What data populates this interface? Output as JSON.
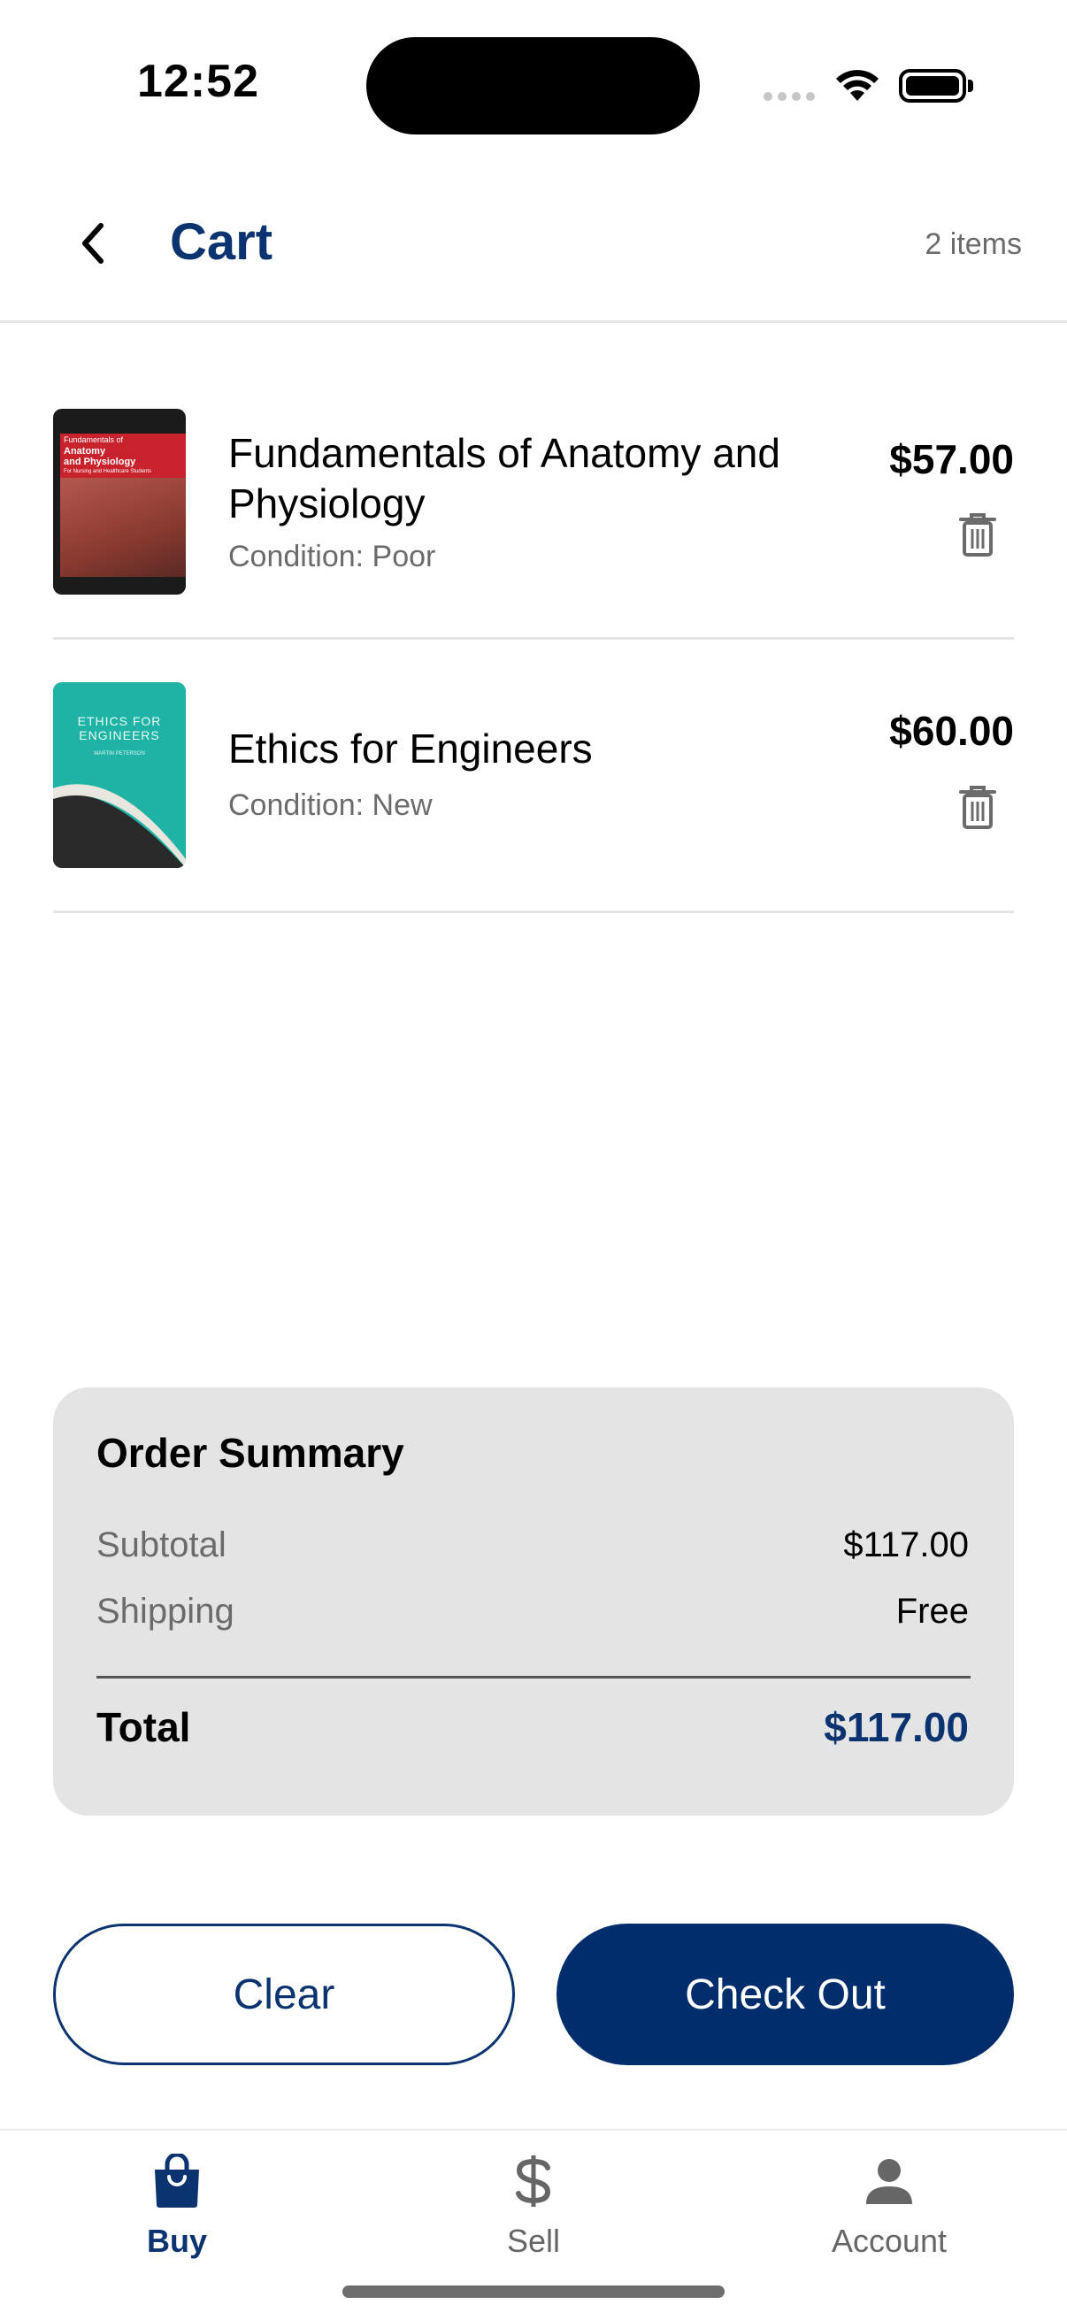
{
  "status_bar": {
    "time": "12:52"
  },
  "header": {
    "title": "Cart",
    "item_count": "2 items"
  },
  "cart": {
    "items": [
      {
        "title": "Fundamentals of Anatomy and Physiology",
        "condition": "Condition: Poor",
        "price": "$57.00",
        "cover": {
          "colors": [
            "#1b1b1b",
            "#c8232c",
            "#b5574f"
          ],
          "text": [
            "Fundamentals of",
            "Anatomy",
            "and Physiology",
            "For Nursing and Healthcare Students"
          ]
        }
      },
      {
        "title": "Ethics for Engineers",
        "condition": "Condition: New",
        "price": "$60.00",
        "cover": {
          "colors": [
            "#1fb3a5",
            "#2a2a2a"
          ],
          "text": [
            "ETHICS FOR",
            "ENGINEERS",
            "MARTIN PETERSON"
          ]
        }
      }
    ]
  },
  "order_summary": {
    "title": "Order Summary",
    "subtotal_label": "Subtotal",
    "subtotal_value": "$117.00",
    "shipping_label": "Shipping",
    "shipping_value": "Free",
    "total_label": "Total",
    "total_value": "$117.00"
  },
  "actions": {
    "clear_label": "Clear",
    "checkout_label": "Check Out"
  },
  "tab_bar": {
    "tabs": [
      {
        "label": "Buy",
        "icon": "shopping-bag-icon",
        "active": true
      },
      {
        "label": "Sell",
        "icon": "dollar-icon",
        "active": false
      },
      {
        "label": "Account",
        "icon": "person-icon",
        "active": false
      }
    ]
  },
  "colors": {
    "brand": "#0b3370",
    "checkout_bg": "#002d6b",
    "summary_bg": "#e4e4e4"
  }
}
